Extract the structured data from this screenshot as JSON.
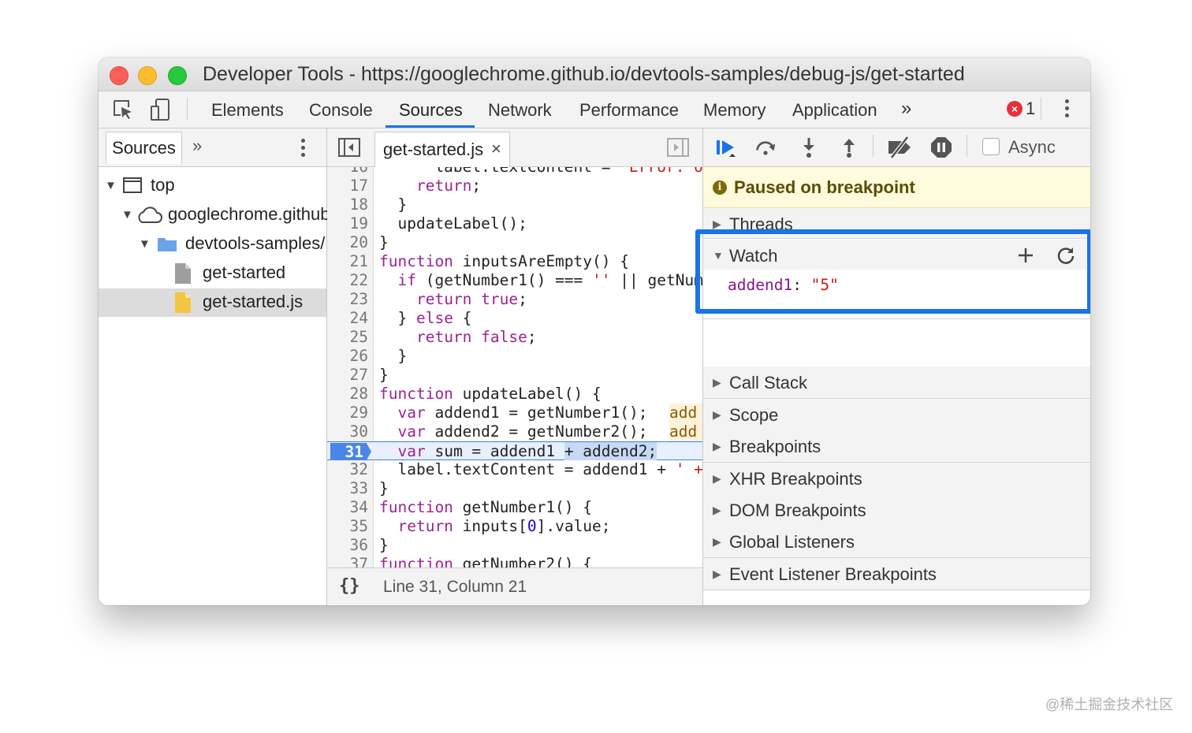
{
  "window": {
    "title": "Developer Tools - https://googlechrome.github.io/devtools-samples/debug-js/get-started"
  },
  "toolbar": {
    "tabs": [
      "Elements",
      "Console",
      "Sources",
      "Network",
      "Performance",
      "Memory",
      "Application"
    ],
    "active_tab": "Sources",
    "more_tabs_glyph": "»",
    "error_count": "1",
    "icons": [
      "inspect-element-icon",
      "device-toolbar-icon",
      "error-icon",
      "more-options-icon"
    ]
  },
  "navigator": {
    "tab_label": "Sources",
    "more_glyph": "»",
    "tree": [
      {
        "label": "top",
        "icon": "frame-icon",
        "expanded": true
      },
      {
        "label": "googlechrome.github",
        "icon": "cloud-icon",
        "expanded": true
      },
      {
        "label": "devtools-samples/",
        "icon": "folder-icon",
        "expanded": true
      },
      {
        "label": "get-started",
        "icon": "document-icon"
      },
      {
        "label": "get-started.js",
        "icon": "script-file-icon",
        "selected": true
      }
    ]
  },
  "editor": {
    "file_tab": "get-started.js",
    "close_glyph": "×",
    "execution_line": "31",
    "inline_values": [
      "add",
      "add"
    ],
    "footer_braces": "{}",
    "cursor_position": "Line 31, Column 21"
  },
  "debugger": {
    "async_label": "Async",
    "paused_message": "Paused on breakpoint",
    "panes": {
      "threads": "Threads",
      "watch": "Watch",
      "call_stack": "Call Stack",
      "scope": "Scope",
      "breakpoints": "Breakpoints",
      "xhr_breakpoints": "XHR Breakpoints",
      "dom_breakpoints": "DOM Breakpoints",
      "global_listeners": "Global Listeners",
      "event_listener_breakpoints": "Event Listener Breakpoints"
    },
    "watch_expression": {
      "name": "addend1",
      "separator": ": ",
      "value": "\"5\""
    },
    "icons": [
      "resume-icon",
      "step-over-icon",
      "step-into-icon",
      "step-out-icon",
      "deactivate-breakpoints-icon",
      "pause-on-exceptions-icon",
      "add-watch-icon",
      "refresh-icon"
    ]
  },
  "colors": {
    "accent": "#1a73e8",
    "paused_banner": "#fffbdc",
    "breakpoint": "#4a86e8"
  },
  "watermark": "@稀土掘金技术社区"
}
